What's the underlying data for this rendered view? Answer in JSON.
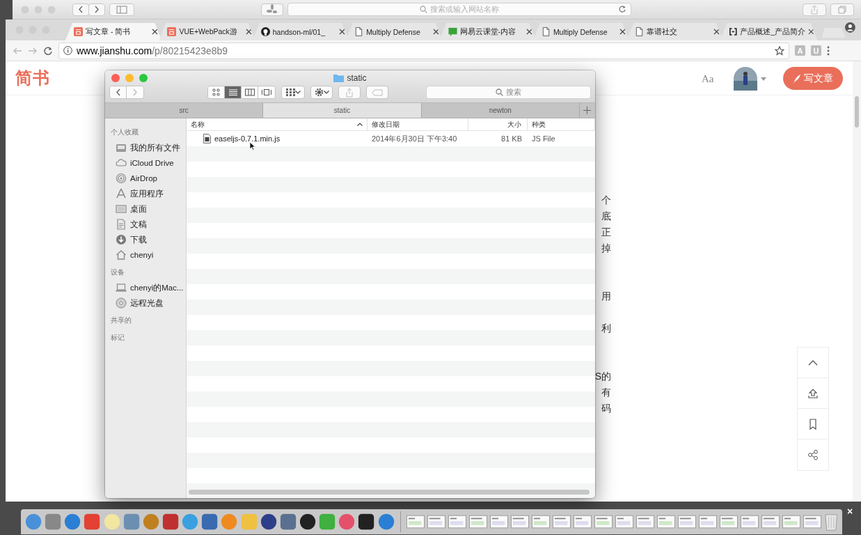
{
  "safari": {
    "search_placeholder": "搜索或输入网站名称"
  },
  "browser": {
    "tabs": [
      {
        "title": "写文章 - 简书",
        "kind": "jianshu",
        "selected": true
      },
      {
        "title": "VUE+WebPack游",
        "kind": "jianshu",
        "selected": false
      },
      {
        "title": "handson-ml/01_",
        "kind": "github",
        "selected": false
      },
      {
        "title": "Multiply Defense",
        "kind": "page",
        "selected": false
      },
      {
        "title": "网易云课堂-内容",
        "kind": "study",
        "selected": false
      },
      {
        "title": "Multiply Defense",
        "kind": "page",
        "selected": false
      },
      {
        "title": "靠谱社交",
        "kind": "page",
        "selected": false
      },
      {
        "title": "产品概述_产品简介",
        "kind": "bracket",
        "selected": false
      }
    ],
    "url_host": "www.jianshu.com",
    "url_path": "/p/80215423e8b9",
    "extensions": [
      "A",
      "U"
    ]
  },
  "page": {
    "logo": "简书",
    "font_button": "Aa",
    "write_button": "写文章",
    "text_fragments": [
      "个",
      "底",
      "正",
      "掉",
      "用",
      "利",
      "S的",
      "有",
      "码"
    ]
  },
  "finder": {
    "title": "static",
    "search_placeholder": "搜索",
    "view_modes": [
      {
        "kind": "icons",
        "selected": false
      },
      {
        "kind": "list",
        "selected": true
      },
      {
        "kind": "columns",
        "selected": false
      },
      {
        "kind": "cover",
        "selected": false
      }
    ],
    "path_tabs": [
      {
        "label": "src",
        "selected": false
      },
      {
        "label": "static",
        "selected": true
      },
      {
        "label": "newton",
        "selected": false
      }
    ],
    "sidebar": [
      {
        "heading": "个人收藏",
        "items": [
          {
            "label": "我的所有文件",
            "kind": "drawer"
          },
          {
            "label": "iCloud Drive",
            "kind": "cloud"
          },
          {
            "label": "AirDrop",
            "kind": "airdrop"
          },
          {
            "label": "应用程序",
            "kind": "apps"
          },
          {
            "label": "桌面",
            "kind": "desktop"
          },
          {
            "label": "文稿",
            "kind": "doc"
          },
          {
            "label": "下载",
            "kind": "download"
          },
          {
            "label": "chenyi",
            "kind": "home"
          }
        ]
      },
      {
        "heading": "设备",
        "items": [
          {
            "label": "chenyi的Mac...",
            "kind": "laptop"
          },
          {
            "label": "远程光盘",
            "kind": "disc"
          }
        ]
      },
      {
        "heading": "共享的"
      },
      {
        "heading": "标记"
      }
    ],
    "columns": [
      {
        "label": "名称",
        "sorted": true
      },
      {
        "label": "修改日期",
        "sorted": false
      },
      {
        "label": "大小",
        "sorted": false
      },
      {
        "label": "种类",
        "sorted": false
      }
    ],
    "rows": [
      {
        "name": "easeljs-0.7.1.min.js",
        "date": "2014年6月30日 下午3:40",
        "size": "81 KB",
        "file_kind": "JS File"
      }
    ]
  },
  "dock": {
    "close_glyph": "×"
  }
}
